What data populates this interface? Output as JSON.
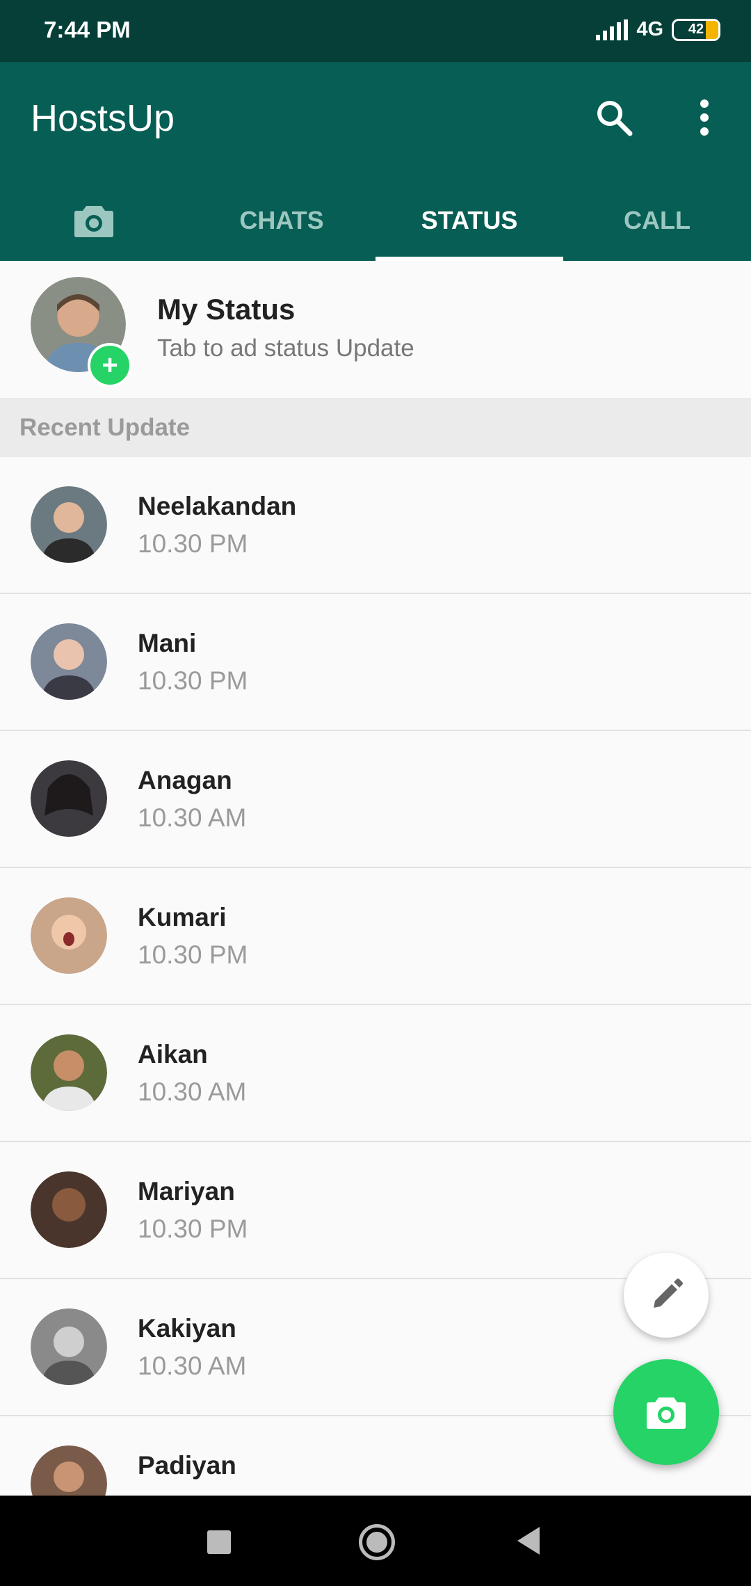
{
  "status_bar": {
    "time": "7:44 PM",
    "network": "4G",
    "battery": "42"
  },
  "app": {
    "title": "HostsUp"
  },
  "tabs": [
    {
      "label": "CHATS"
    },
    {
      "label": "STATUS",
      "active": true
    },
    {
      "label": "CALL"
    }
  ],
  "my_status": {
    "title": "My Status",
    "subtitle": "Tab to ad status Update"
  },
  "section": {
    "recent_label": "Recent Update"
  },
  "contacts": [
    {
      "name": "Neelakandan",
      "time": "10.30 PM",
      "avatar_color": "#6b7a80"
    },
    {
      "name": "Mani",
      "time": "10.30 PM",
      "avatar_color": "#7d8899"
    },
    {
      "name": "Anagan",
      "time": "10.30 AM",
      "avatar_color": "#3d3a3f"
    },
    {
      "name": "Kumari",
      "time": "10.30 PM",
      "avatar_color": "#c9a58a"
    },
    {
      "name": "Aikan",
      "time": "10.30 AM",
      "avatar_color": "#5d6a3a"
    },
    {
      "name": "Mariyan",
      "time": "10.30 PM",
      "avatar_color": "#4a352d"
    },
    {
      "name": "Kakiyan",
      "time": "10.30 AM",
      "avatar_color": "#8a8a8a"
    },
    {
      "name": "Padiyan",
      "time": "",
      "avatar_color": "#7a5b4a"
    }
  ],
  "colors": {
    "primary": "#075e54",
    "status_bar": "#053f38",
    "accent": "#25d366"
  },
  "icons": {
    "search": "search-icon",
    "more": "more-vert-icon",
    "camera_tab": "camera-icon",
    "fab_edit": "pencil-icon",
    "fab_camera": "camera-icon",
    "add": "plus-icon"
  }
}
